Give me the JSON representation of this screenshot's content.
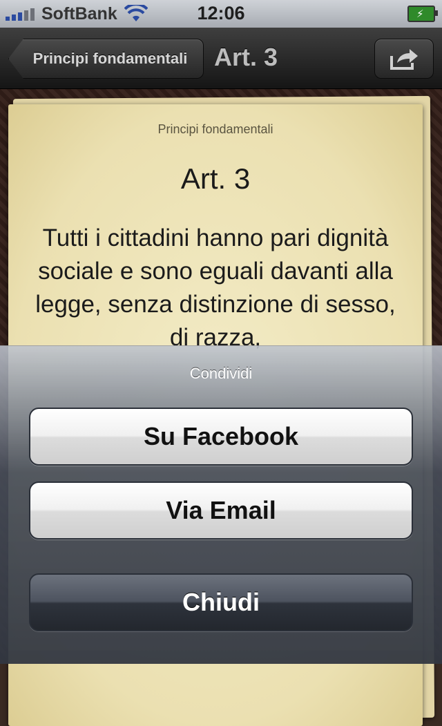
{
  "status_bar": {
    "carrier": "SoftBank",
    "time": "12:06",
    "battery_icon": "battery-charging-icon",
    "wifi_icon": "wifi-icon"
  },
  "nav_bar": {
    "back_label": "Principi fondamentali",
    "title": "Art. 3",
    "share_icon": "share-icon"
  },
  "article": {
    "section": "Principi fondamentali",
    "title": "Art. 3",
    "body": "Tutti i cittadini hanno pari dignità sociale e sono eguali davanti alla legge, senza distinzione di sesso, di razza,"
  },
  "action_sheet": {
    "title": "Condividi",
    "facebook_label": "Su Facebook",
    "email_label": "Via Email",
    "close_label": "Chiudi"
  },
  "colors": {
    "nav_background": "#1f1f1f",
    "paper": "#efe6bc",
    "sheet_button_dark": "#2e333c"
  }
}
